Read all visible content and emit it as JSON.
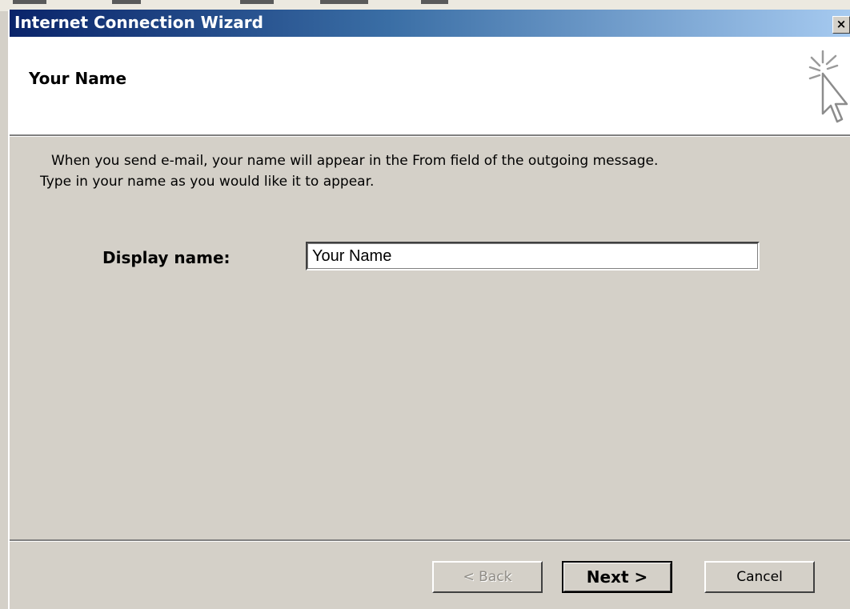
{
  "window": {
    "title": "Internet Connection Wizard",
    "close_symbol": "×"
  },
  "header": {
    "heading": "Your Name",
    "icon": "wizard-cursor-icon"
  },
  "body": {
    "instruction_line1": "When you send e-mail, your name will appear in the From field of the outgoing message.",
    "instruction_line2": "Type in your name as you would like it to appear.",
    "display_name_label": "Display name:",
    "display_name_value": "Your Name"
  },
  "buttons": {
    "back": "< Back",
    "next": "Next >",
    "cancel": "Cancel"
  },
  "colors": {
    "title_gradient_start": "#0a246a",
    "title_gradient_end": "#a6caf0",
    "dialog_face": "#d4d0c8"
  }
}
